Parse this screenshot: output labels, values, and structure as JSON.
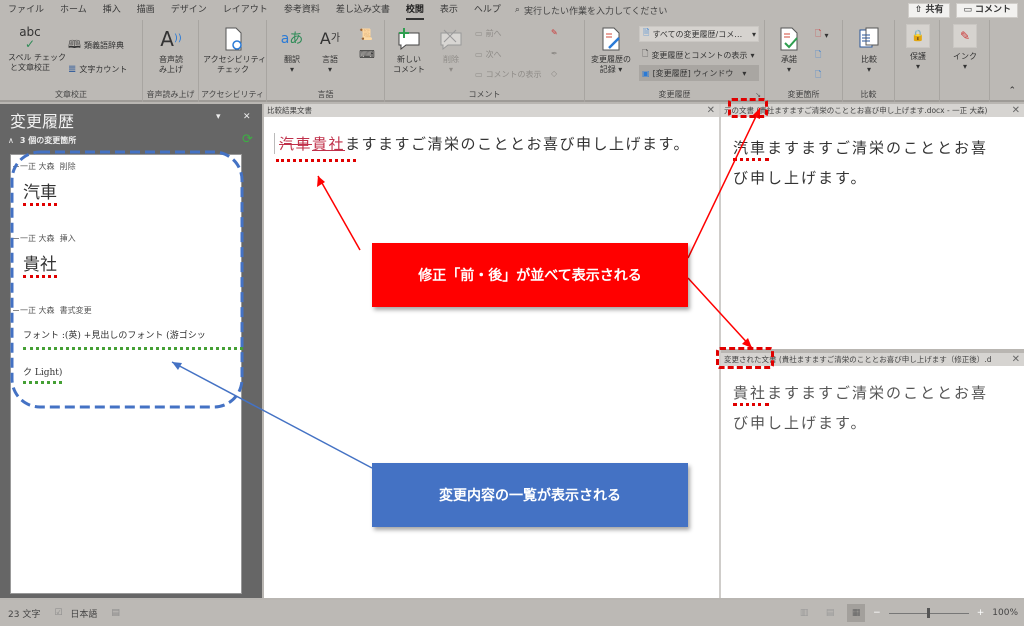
{
  "menu": {
    "tabs": [
      "ファイル",
      "ホーム",
      "挿入",
      "描画",
      "デザイン",
      "レイアウト",
      "参考資料",
      "差し込み文書",
      "校閲",
      "表示",
      "ヘルプ"
    ],
    "active_tab": "校閲",
    "tell_me": "実行したい作業を入力してください",
    "share_label": "共有",
    "comment_label": "コメント"
  },
  "ribbon": {
    "proofing": {
      "label": "文章校正",
      "spell": "スペル チェック\nと文章校正",
      "spell_line1": "スペル チェック",
      "spell_line2": "と文章校正",
      "spell_icon_text": "abc",
      "thesaurus": "類義語辞典",
      "wordcount": "文字カウント"
    },
    "speech": {
      "label": "音声読み上げ",
      "read_line1": "音声読",
      "read_line2": "み上げ"
    },
    "accessibility": {
      "label": "アクセシビリティ",
      "check_line1": "アクセシビリティ",
      "check_line2": "チェック"
    },
    "language": {
      "label": "言語",
      "translate": "翻訳",
      "language": "言語"
    },
    "comments": {
      "label": "コメント",
      "new_line1": "新しい",
      "new_line2": "コメント",
      "delete": "削除",
      "prev": "前へ",
      "next": "次へ",
      "show": "コメントの表示"
    },
    "tracking": {
      "label": "変更履歴",
      "track_line1": "変更履歴の",
      "track_line2": "記録",
      "markup": "すべての変更履歴/コメ…",
      "show_markup": "変更履歴とコメントの表示",
      "pane": "[変更履歴] ウィンドウ"
    },
    "changes": {
      "label": "変更箇所",
      "accept": "承諾"
    },
    "compare": {
      "label": "比較",
      "compare": "比較"
    },
    "protect": {
      "label": "保護"
    },
    "ink": {
      "label": "インク"
    }
  },
  "revisions_pane": {
    "title": "変更履歴",
    "summary": "3 個の変更箇所",
    "items": [
      {
        "author": "一正 大森",
        "type": "削除",
        "text": "汽車"
      },
      {
        "author": "一正 大森",
        "type": "挿入",
        "text": "貴社"
      },
      {
        "author": "一正 大森",
        "type": "書式変更",
        "text_line1": "フォント :(英) +見出しのフォント (游ゴシッ",
        "text_line2": "ク Light)"
      }
    ]
  },
  "compared_doc": {
    "header": "比較結果文書",
    "deleted": "汽車",
    "inserted": "貴社",
    "rest": "ますますご清栄のこととお喜び申し上げます。"
  },
  "original_doc": {
    "header": "元の文書 (貴社ますますご清栄のこととお喜び申し上げます.docx - 一正 大森)",
    "line1": "汽車ますますご清栄のこととお喜",
    "line2": "び申し上げます。"
  },
  "revised_doc": {
    "header": "変更された文書 (貴社ますますご清栄のこととお喜び申し上げます（修正後）.d",
    "line1": "貴社ますますご清栄のこととお喜",
    "line2": "び申し上げます。"
  },
  "callouts": {
    "red": {
      "text": "修正「前・後」が並べて表示される",
      "color": "#ff0000"
    },
    "blue": {
      "text": "変更内容の一覧が表示される",
      "color": "#4472c4"
    }
  },
  "status": {
    "word_count": "23 文字",
    "language": "日本語",
    "zoom_percent": 100,
    "zoom_label": "100%"
  }
}
